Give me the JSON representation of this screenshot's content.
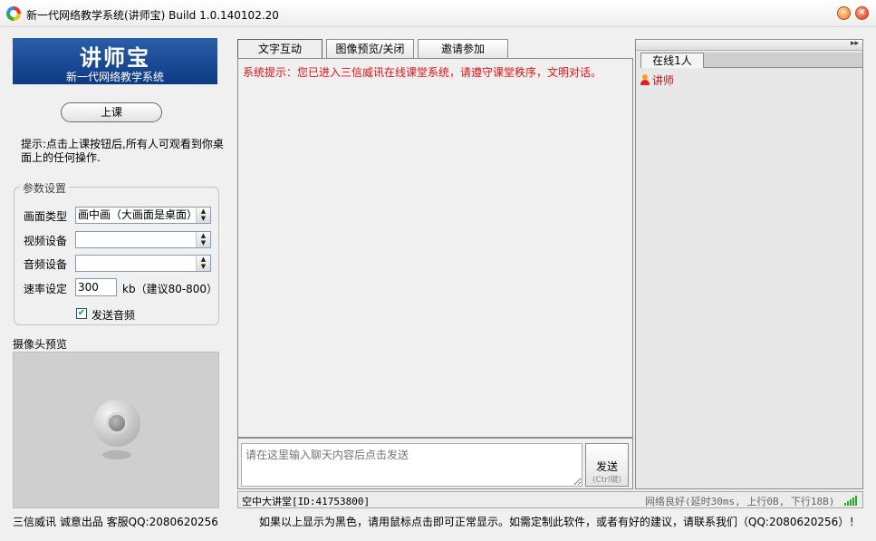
{
  "window": {
    "title": "新一代网络教学系统(讲师宝) Build 1.0.140102.20",
    "minimize_glyph": "–",
    "close_glyph": "×"
  },
  "logo": {
    "title": "讲师宝",
    "subtitle": "新一代网络教学系统"
  },
  "left": {
    "start_button": "上课",
    "hint": "提示:点击上课按钮后,所有人可观看到你桌面上的任何操作.",
    "settings": {
      "legend": "参数设置",
      "screen_type_label": "画面类型",
      "screen_type_value": "画中画（大画面是桌面）",
      "video_label": "视频设备",
      "video_value": "",
      "audio_label": "音频设备",
      "audio_value": "",
      "rate_label": "速率设定",
      "rate_value": "300",
      "rate_hint": "kb（建议80-800）",
      "send_audio_label": "发送音频",
      "send_audio_checked": "✔"
    },
    "camera_label": "摄像头预览",
    "footer": "三信威讯 诚意出品 客服QQ:2080620256"
  },
  "tabs": [
    {
      "label": "文字互动"
    },
    {
      "label": "图像预览/关闭"
    },
    {
      "label": "邀请参加"
    }
  ],
  "chat": {
    "system_message": "系统提示：您已进入三信威讯在线课堂系统，请遵守课堂秩序，文明对话。",
    "input_placeholder": "请在这里输入聊天内容后点击发送",
    "send_label": "发送",
    "send_hint": "(Ctrl键)"
  },
  "online": {
    "collapse_glyph": "▸▸",
    "tab_label": "在线1人",
    "users": [
      {
        "name": "讲师"
      }
    ]
  },
  "status": {
    "room": "空中大讲堂[ID:41753800]",
    "network": "网络良好(延时30ms, 上行0B, 下行18B)"
  },
  "footer_notice": "如果以上显示为黑色，请用鼠标点击即可正常显示。如需定制此软件，或者有好的建议，请联系我们（QQ:2080620256）！",
  "colors": {
    "accent_red": "#e01414",
    "logo_blue": "#0e3a84"
  }
}
